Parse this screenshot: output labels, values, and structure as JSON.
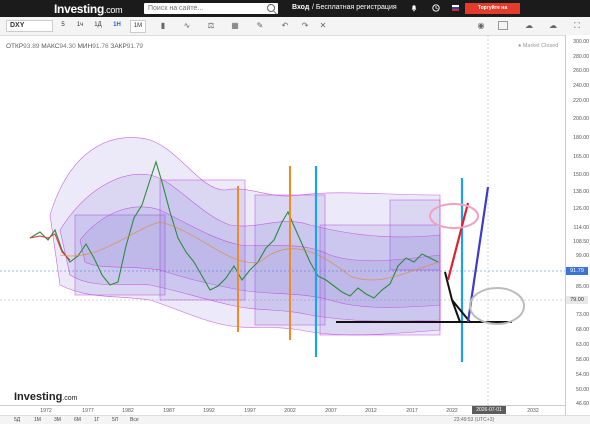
{
  "header": {
    "logo_main": "Investing",
    "logo_domain": ".com",
    "search_placeholder": "Поиск на сайте...",
    "login": "Вход",
    "register": "/ Бесплатная регистрация",
    "ad_button": "Торгуйте на выгодных условиях"
  },
  "toolbar": {
    "symbol": "DXY",
    "timeframes": [
      "5",
      "1ч",
      "1Д",
      "1Н",
      "1М"
    ],
    "active_timeframe": "1Н"
  },
  "ohlc": {
    "open_label": "ОТКР",
    "open": "93.89",
    "high_label": "МАКС",
    "high": "94.30",
    "low_label": "МИН",
    "low": "91.76",
    "close_label": "ЗАКР",
    "close": "91.79"
  },
  "market_status": "● Market Closed",
  "price_axis": {
    "ticks": [
      "300.00",
      "280.00",
      "260.00",
      "240.00",
      "220.00",
      "200.00",
      "180.00",
      "165.00",
      "150.00",
      "138.00",
      "126.00",
      "114.00",
      "108.50",
      "99.00",
      "93.00",
      "85.00",
      "79.00",
      "73.00",
      "68.00",
      "63.00",
      "58.00",
      "54.00",
      "50.00",
      "46.60"
    ],
    "last_price": "91.79",
    "mark_price": "79.00"
  },
  "time_axis": {
    "ticks": [
      "1972",
      "1977",
      "1982",
      "1987",
      "1992",
      "1997",
      "2002",
      "2007",
      "2012",
      "2017",
      "2022",
      "2027",
      "2032"
    ],
    "crosshair_date": "2026-07-01"
  },
  "watermark": {
    "main": "Investing",
    "domain": ".com"
  },
  "bottom_bar": {
    "ranges": [
      "5Д",
      "1М",
      "3М",
      "6М",
      "1Г",
      "5Л",
      "Все"
    ],
    "utc": "23:49:53 (UTC+3)"
  },
  "colors": {
    "accent": "#1e63d0",
    "band_fill": "#6a5acd",
    "band_edge": "#c040e0",
    "orange": "#f08a24",
    "cyan": "#1aa3e8",
    "red": "#e0202a",
    "blue": "#3b3bcc",
    "price_line": "#3b73d6"
  },
  "icons": [
    "search-icon",
    "bell-icon",
    "clock-icon",
    "flag-ru-icon",
    "camera-icon",
    "cloud-icon",
    "fullscreen-icon"
  ]
}
